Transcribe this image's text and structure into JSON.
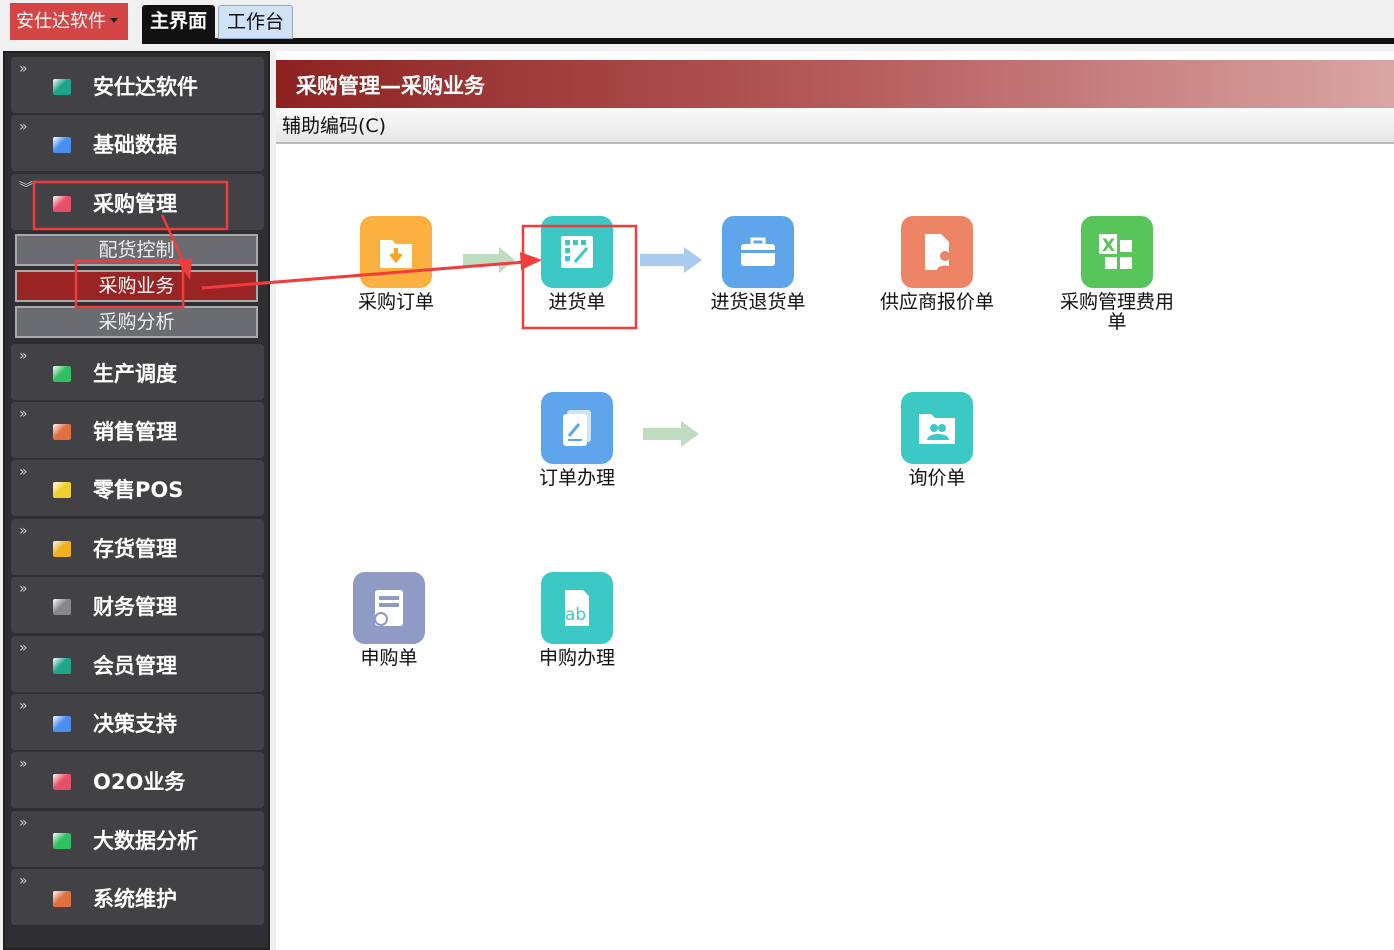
{
  "topbar": {
    "brand": "安仕达软件",
    "tabs": [
      "主界面",
      "工作台"
    ]
  },
  "sidebar": {
    "items": [
      {
        "label": "安仕达软件",
        "color": "#1fa58a"
      },
      {
        "label": "基础数据",
        "color": "#4a8ef0"
      },
      {
        "label": "采购管理",
        "color": "#e8506a"
      },
      {
        "label": "生产调度",
        "color": "#30c060"
      },
      {
        "label": "销售管理",
        "color": "#e07040"
      },
      {
        "label": "零售POS",
        "color": "#f0d030"
      },
      {
        "label": "存货管理",
        "color": "#f0b020"
      },
      {
        "label": "财务管理",
        "color": "#888888"
      },
      {
        "label": "会员管理",
        "color": "#1fa58a"
      },
      {
        "label": "决策支持",
        "color": "#4a8ef0"
      },
      {
        "label": "O2O业务",
        "color": "#e8506a"
      },
      {
        "label": "大数据分析",
        "color": "#30c060"
      },
      {
        "label": "系统维护",
        "color": "#e07040"
      }
    ],
    "subitems": [
      "配货控制",
      "采购业务",
      "采购分析"
    ]
  },
  "main": {
    "title": "采购管理—采购业务",
    "toolbar": "辅助编码(C)",
    "tiles": [
      {
        "label": "采购订单",
        "color": "#fbb040",
        "icon": "folder-download-icon"
      },
      {
        "label": "进货单",
        "color": "#3cc9c5",
        "icon": "edit-grid-icon"
      },
      {
        "label": "进货退货单",
        "color": "#5fa5ec",
        "icon": "briefcase-icon"
      },
      {
        "label": "供应商报价单",
        "color": "#ee8466",
        "icon": "document-person-icon"
      },
      {
        "label": "采购管理费用单",
        "color": "#58c55a",
        "icon": "excel-icon"
      },
      {
        "label": "订单办理",
        "color": "#5fa5ec",
        "icon": "document-pen-icon"
      },
      {
        "label": "询价单",
        "color": "#3cc9c5",
        "icon": "folder-users-icon"
      },
      {
        "label": "申购单",
        "color": "#8f9ac5",
        "icon": "form-check-icon"
      },
      {
        "label": "申购办理",
        "color": "#3cc9c5",
        "icon": "text-ab-icon"
      }
    ]
  }
}
